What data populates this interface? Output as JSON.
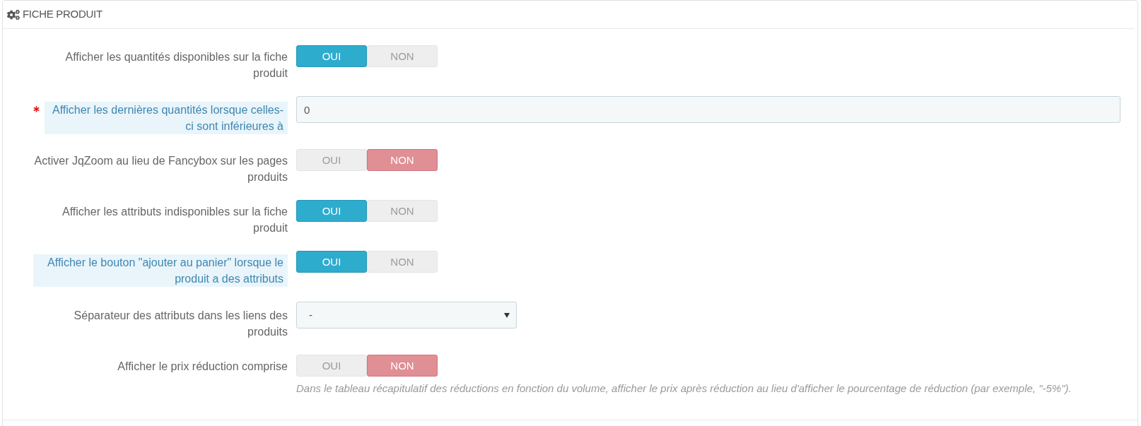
{
  "panel": {
    "title": "FICHE PRODUIT"
  },
  "fields": [
    {
      "kind": "toggle",
      "label": "Afficher les quantités disponibles sur la fiche produit",
      "required": false,
      "highlighted": false,
      "options": [
        {
          "label": "OUI",
          "selected": true
        },
        {
          "label": "NON",
          "selected": false
        }
      ]
    },
    {
      "kind": "text",
      "label": "Afficher les dernières quantités lorsque celles-ci sont inférieures à",
      "required": true,
      "highlighted": true,
      "value": "0"
    },
    {
      "kind": "toggle",
      "label": "Activer JqZoom au lieu de Fancybox sur les pages produits",
      "required": false,
      "highlighted": false,
      "options": [
        {
          "label": "OUI",
          "selected": false
        },
        {
          "label": "NON",
          "selected": true
        }
      ]
    },
    {
      "kind": "toggle",
      "label": "Afficher les attributs indisponibles sur la fiche produit",
      "required": false,
      "highlighted": false,
      "options": [
        {
          "label": "OUI",
          "selected": true
        },
        {
          "label": "NON",
          "selected": false
        }
      ]
    },
    {
      "kind": "toggle",
      "label": "Afficher le bouton \"ajouter au panier\" lorsque le produit a des attributs",
      "required": false,
      "highlighted": true,
      "options": [
        {
          "label": "OUI",
          "selected": true
        },
        {
          "label": "NON",
          "selected": false
        }
      ]
    },
    {
      "kind": "select",
      "label": "Séparateur des attributs dans les liens des produits",
      "required": false,
      "highlighted": false,
      "value": "-"
    },
    {
      "kind": "toggle",
      "label": "Afficher le prix réduction comprise",
      "required": false,
      "highlighted": false,
      "options": [
        {
          "label": "OUI",
          "selected": false
        },
        {
          "label": "NON",
          "selected": true
        }
      ],
      "help": "Dans le tableau récapitulatif des réductions en fonction du volume, afficher le prix après réduction au lieu d'afficher le pourcentage de réduction (par exemple, \"-5%\")."
    }
  ]
}
